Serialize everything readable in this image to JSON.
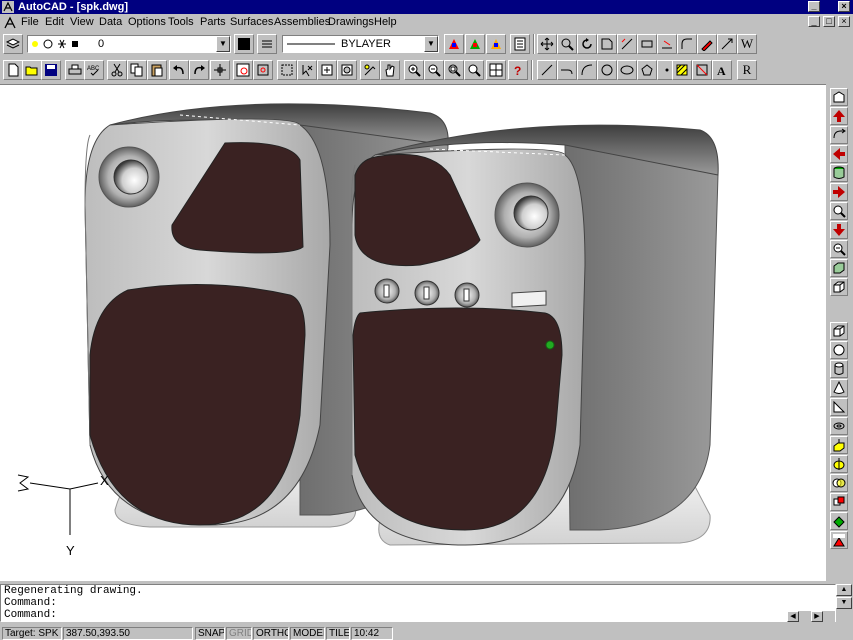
{
  "window": {
    "title": "AutoCAD - [spk.dwg]",
    "controls": {
      "minimize": "_",
      "close": "×",
      "restore": "□"
    }
  },
  "menu": {
    "items": [
      "File",
      "Edit",
      "View",
      "Data",
      "Options",
      "Tools",
      "Parts",
      "Surfaces",
      "Assemblies",
      "Drawings",
      "Help"
    ]
  },
  "object_properties": {
    "layer_value": "0",
    "linetype_value": "BYLAYER",
    "color_swatch": "#000000"
  },
  "toolbar_labels": {
    "w_button": "W",
    "r_button": "R"
  },
  "ucs_icon": {
    "x_label": "X",
    "y_label": "Y",
    "z_label": "Z"
  },
  "command_window": {
    "lines": [
      "Regenerating drawing.",
      "Command:",
      "Command:"
    ]
  },
  "status_bar": {
    "target": "Target: SPK",
    "coords": "387.50,393.50",
    "snap": "SNAP",
    "grid": "GRID",
    "ortho": "ORTHO",
    "model": "MODEL",
    "tile": "TILE",
    "time": "10:42"
  },
  "colors": {
    "title_bar": "#000080",
    "chrome": "#c0c0c0",
    "speaker_body": "#8a8a8a",
    "speaker_grille": "#3a2222",
    "led": "#22aa22"
  },
  "icons": {
    "left_toolbar_row1": [
      "layers-icon",
      "layer-state-icon"
    ],
    "left_toolbar_row2": [
      "new-icon",
      "open-icon",
      "save-icon",
      "print-icon",
      "spell-icon",
      "cut-icon",
      "copy-icon",
      "paste-icon",
      "undo-icon",
      "redo-icon",
      "snap-icon",
      "zoom-window-icon",
      "help-icon"
    ],
    "right_toolbar": [
      "view-top-icon",
      "arrow-up-icon",
      "rotate-icon",
      "arrow-left-icon",
      "cylinder-icon",
      "arrow-right-icon",
      "zoom-icon",
      "arrow-down-icon",
      "zoom-out-icon",
      "box-icon",
      "cube-icon",
      "sphere-icon",
      "torus-icon",
      "wedge-icon",
      "cone-icon",
      "disk-icon",
      "extrude-icon",
      "revolve-icon",
      "intersect-icon",
      "union-icon",
      "ame-icon"
    ]
  }
}
